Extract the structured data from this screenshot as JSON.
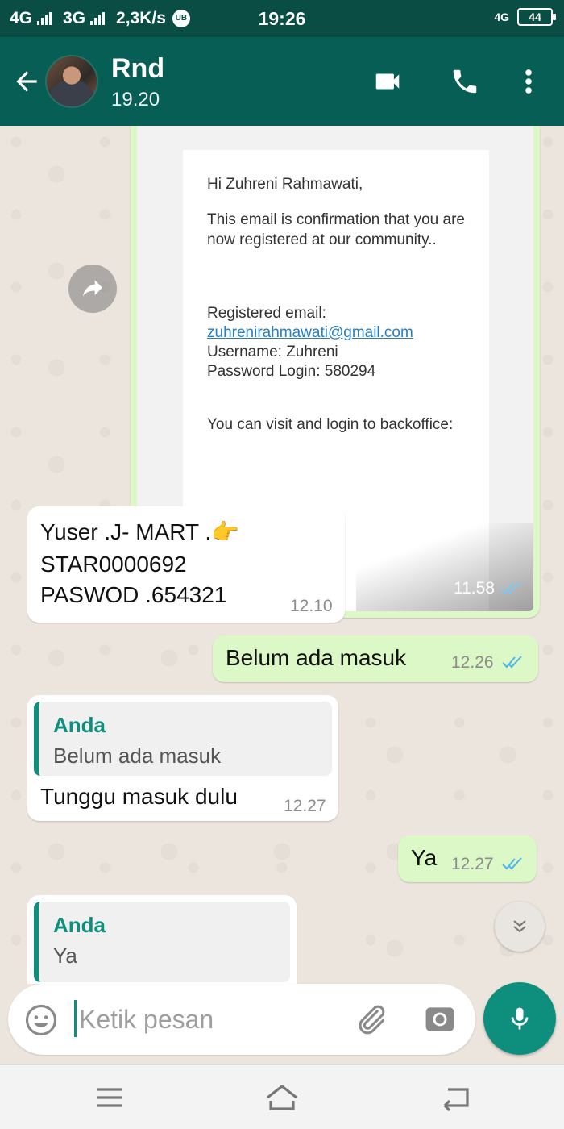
{
  "status_bar": {
    "network1": "4G",
    "network2": "3G",
    "speed": "2,3K/s",
    "badge": "UB",
    "time": "19:26",
    "right_net": "4G",
    "battery": "44"
  },
  "header": {
    "contact_name": "Rnd",
    "subtitle": "19.20",
    "accent": "#075e54"
  },
  "image_message": {
    "email_greeting": "Hi Zuhreni Rahmawati,",
    "email_body": "This email is confirmation that you are now registered at our community..",
    "registered_email_label": "Registered email:",
    "registered_email": "zuhrenirahmawati@gmail.com",
    "username_line": "Username: Zuhreni",
    "password_line": "Password Login: 580294",
    "visit_line": "You can visit and login to backoffice:",
    "time": "11.58"
  },
  "messages": [
    {
      "direction": "in",
      "lines": [
        "Yuser .J- MART .👉",
        "STAR0000692",
        "PASWOD .654321"
      ],
      "time": "12.10"
    },
    {
      "direction": "out",
      "text": "Belum  ada  masuk",
      "time": "12.26"
    },
    {
      "direction": "in",
      "quote_author": "Anda",
      "quote_text": "Belum  ada  masuk",
      "text": "Tunggu masuk dulu",
      "time": "12.27"
    },
    {
      "direction": "out",
      "text": "Ya",
      "time": "12.27"
    },
    {
      "direction": "in",
      "quote_author": "Anda",
      "quote_text": "Ya"
    }
  ],
  "input": {
    "placeholder": "Ketik pesan"
  },
  "colors": {
    "outgoing_bubble": "#dcf8c6",
    "incoming_bubble": "#ffffff",
    "read_ticks": "#4fb6ec",
    "quote_accent": "#0e8f7e"
  }
}
